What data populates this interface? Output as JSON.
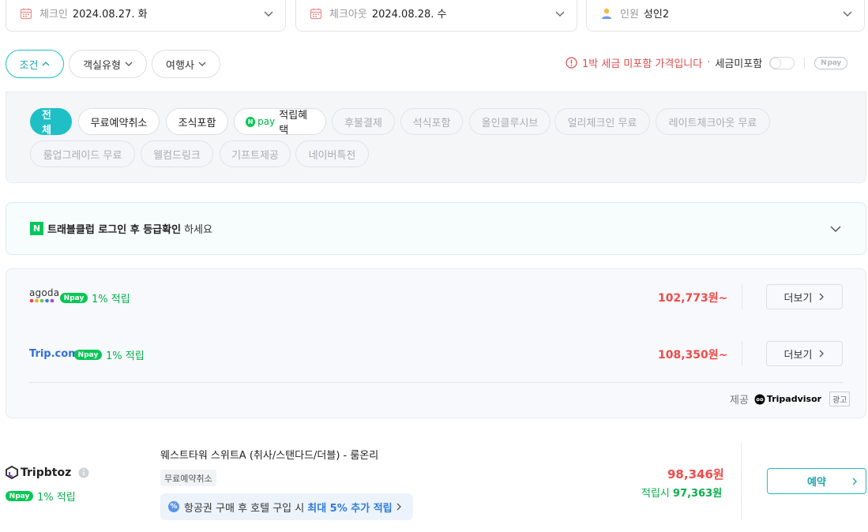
{
  "search": {
    "checkin_label": "체크인",
    "checkin_value": "2024.08.27. 화",
    "checkout_label": "체크아웃",
    "checkout_value": "2024.08.28. 수",
    "guests_label": "인원",
    "guests_value": "성인2"
  },
  "filters": {
    "condition": "조건",
    "room_type": "객실유형",
    "agency": "여행사"
  },
  "tax": {
    "warning": "1박 세금 미포함 가격입니다",
    "separator": "·",
    "toggle_label": "세금미포함",
    "npay": "pay"
  },
  "conditions": {
    "row1": [
      "전체",
      "무료예약취소",
      "조식포함",
      "적립혜택",
      "후불결제",
      "석식포함",
      "올인클루시브",
      "얼리체크인 무료",
      "레이트체크아웃 무료"
    ],
    "row2": [
      "룸업그레이드 무료",
      "웰컴드링크",
      "기프트제공",
      "네이버특전"
    ],
    "npay_tag_prefix": "pay"
  },
  "club": {
    "logo": "N",
    "bold": "트래블클럽 로그인 후 등급확인",
    "rest": "하세요"
  },
  "offers": [
    {
      "provider": "agoda",
      "npay": "pay",
      "points": "1% 적립",
      "price": "102,773원~",
      "more": "더보기"
    },
    {
      "provider": "Trip.com",
      "npay": "pay",
      "points": "1% 적립",
      "price": "108,350원~",
      "more": "더보기"
    }
  ],
  "provided": {
    "label": "제공",
    "brand": "Tripadvisor",
    "ad": "광고"
  },
  "room": {
    "provider": "Tripbtoz",
    "npay": "pay",
    "points": "1% 적립",
    "title": "웨스트타워 스위트A (취사/스탠다드/더블) - 룸온리",
    "cancel_tag": "무료예약취소",
    "promo_text": "항공권 구매 후 호텔 구입 시",
    "promo_highlight": "최대 5% 추가 적립",
    "price": "98,346원",
    "points_price_label": "적립시",
    "points_price": "97,363원",
    "book_label": "예약"
  },
  "colors": {
    "accent": "#1fbfc6",
    "price_red": "#f04a4a",
    "npay_green": "#06c755"
  }
}
